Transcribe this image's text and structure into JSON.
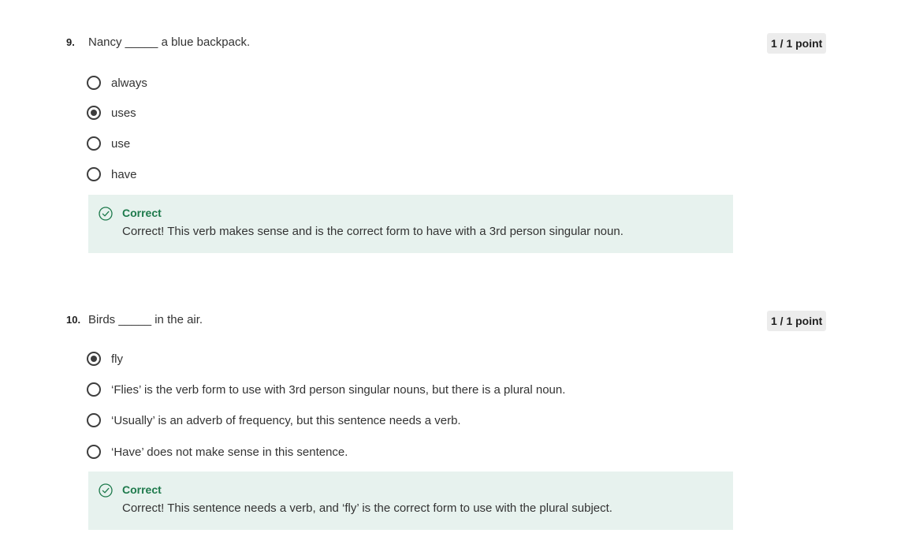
{
  "questions": [
    {
      "number": "9.",
      "text": "Nancy _____ a blue backpack.",
      "points": "1 / 1 point",
      "options": [
        {
          "label": "always",
          "selected": false
        },
        {
          "label": "uses",
          "selected": true
        },
        {
          "label": "use",
          "selected": false
        },
        {
          "label": "have",
          "selected": false
        }
      ],
      "feedback": {
        "icon": "check-circle-icon",
        "title": "Correct",
        "text": "Correct! This verb makes sense and is the correct form to have with a 3rd person singular noun."
      }
    },
    {
      "number": "10.",
      "text": "Birds _____ in the air.",
      "points": "1 / 1 point",
      "options": [
        {
          "label": "fly",
          "selected": true
        },
        {
          "label": "‘Flies’ is the verb form to use with 3rd person singular nouns, but there is a plural noun.",
          "selected": false
        },
        {
          "label": "‘Usually’ is an adverb of frequency, but this sentence needs a verb.",
          "selected": false
        },
        {
          "label": "‘Have’ does not make sense in this sentence.",
          "selected": false
        }
      ],
      "feedback": {
        "icon": "check-circle-icon",
        "title": "Correct",
        "text": "Correct! This sentence needs a verb, and ‘fly’ is the correct form to use with the plural subject."
      }
    }
  ],
  "colors": {
    "correct_green": "#1e7a4c",
    "feedback_bg": "#e7f2ee",
    "points_bg": "#ececec"
  }
}
